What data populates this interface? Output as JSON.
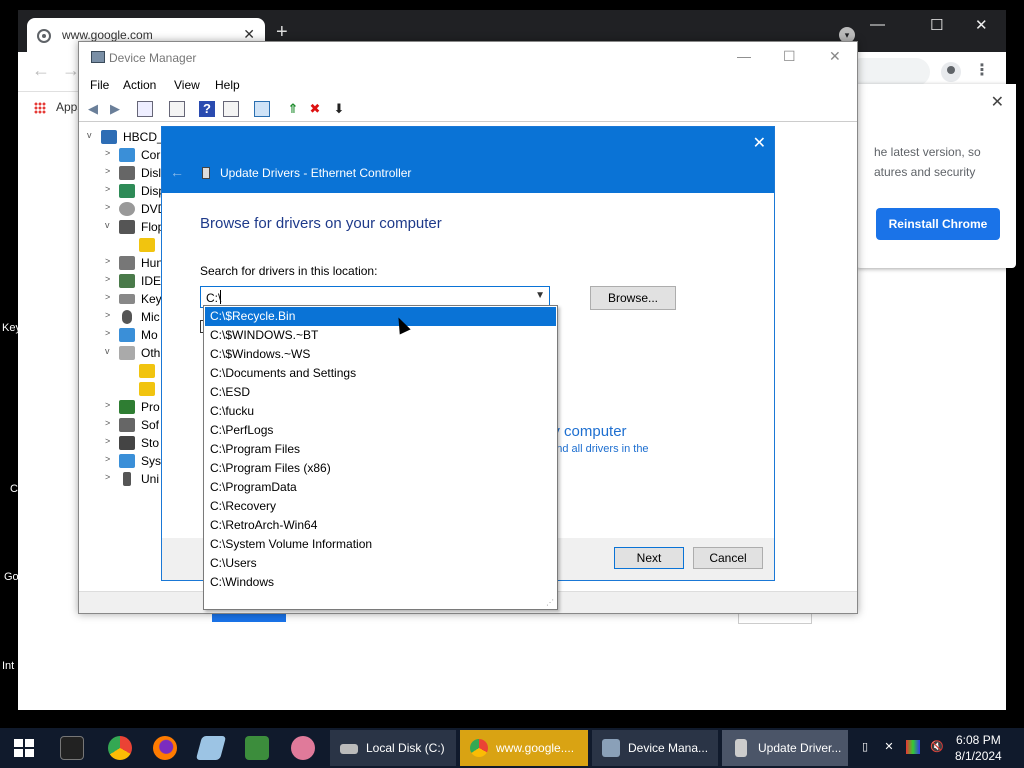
{
  "desktop": {
    "labels": [
      "Key",
      "C",
      "Go",
      "Int"
    ]
  },
  "chrome": {
    "tab_title": "www.google.com",
    "new_tab": "+",
    "bookmark_apps": "Apps",
    "popup": {
      "text": "he latest version, so atures and security",
      "button": "Reinstall Chrome"
    }
  },
  "device_manager": {
    "title": "Device Manager",
    "menu": [
      "File",
      "Action",
      "View",
      "Help"
    ],
    "tree": [
      {
        "label": "HBCD_",
        "expander": "v"
      },
      {
        "label": "Cor",
        "expander": ">"
      },
      {
        "label": "Disl",
        "expander": ">"
      },
      {
        "label": "Disp",
        "expander": ">"
      },
      {
        "label": "DVD",
        "expander": ">"
      },
      {
        "label": "Flop",
        "expander": "v"
      },
      {
        "label": "",
        "expander": ""
      },
      {
        "label": "Hun",
        "expander": ">"
      },
      {
        "label": "IDE",
        "expander": ">"
      },
      {
        "label": "Key",
        "expander": ">"
      },
      {
        "label": "Mic",
        "expander": ">"
      },
      {
        "label": "Mo",
        "expander": ">"
      },
      {
        "label": "Oth",
        "expander": "v"
      },
      {
        "label": "",
        "expander": ""
      },
      {
        "label": "",
        "expander": ""
      },
      {
        "label": "Pro",
        "expander": ">"
      },
      {
        "label": "Sof",
        "expander": ">"
      },
      {
        "label": "Sto",
        "expander": ">"
      },
      {
        "label": "Syst",
        "expander": ">"
      },
      {
        "label": "Uni",
        "expander": ">"
      }
    ]
  },
  "update_drivers": {
    "title": "Update Drivers - Ethernet Controller",
    "heading": "Browse for drivers on your computer",
    "search_label": "Search for drivers in this location:",
    "path_value": "C:\\",
    "browse_button": "Browse...",
    "option_title": "ny computer",
    "option_desc": ", and all drivers in the",
    "next_button": "Next",
    "cancel_button": "Cancel",
    "dropdown_items": [
      "C:\\$Recycle.Bin",
      "C:\\$WINDOWS.~BT",
      "C:\\$Windows.~WS",
      "C:\\Documents and Settings",
      "C:\\ESD",
      "C:\\fucku",
      "C:\\PerfLogs",
      "C:\\Program Files",
      "C:\\Program Files (x86)",
      "C:\\ProgramData",
      "C:\\Recovery",
      "C:\\RetroArch-Win64",
      "C:\\System Volume Information",
      "C:\\Users",
      "C:\\Windows"
    ],
    "dropdown_selected": "C:\\$Recycle.Bin"
  },
  "taskbar": {
    "apps": [
      {
        "label": "Local Disk (C:)",
        "icon": "drive-icon"
      },
      {
        "label": "www.google....",
        "icon": "chrome-icon"
      },
      {
        "label": "Device Mana...",
        "icon": "device-manager-icon"
      },
      {
        "label": "Update Driver...",
        "icon": "update-driver-icon"
      }
    ],
    "time": "6:08 PM",
    "date": "8/1/2024"
  }
}
